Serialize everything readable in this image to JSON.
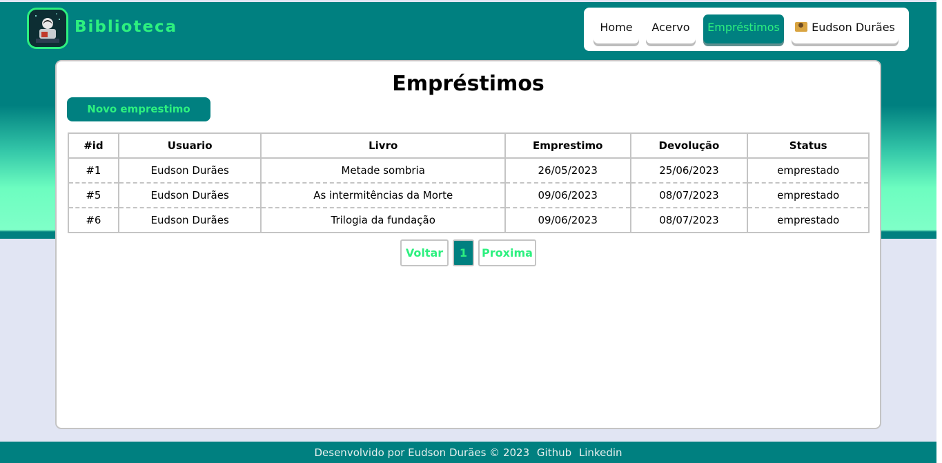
{
  "brand": {
    "name": "Biblioteca"
  },
  "nav": {
    "home": "Home",
    "acervo": "Acervo",
    "emprestimos": "Empréstimos",
    "user": "Eudson Durães"
  },
  "main": {
    "title": "Empréstimos",
    "new_button": "Novo emprestimo",
    "table": {
      "headers": [
        "#id",
        "Usuario",
        "Livro",
        "Emprestimo",
        "Devolução",
        "Status"
      ],
      "rows": [
        [
          "#1",
          "Eudson Durães",
          "Metade sombria",
          "26/05/2023",
          "25/06/2023",
          "emprestado"
        ],
        [
          "#5",
          "Eudson Durães",
          "As intermitências da Morte",
          "09/06/2023",
          "08/07/2023",
          "emprestado"
        ],
        [
          "#6",
          "Eudson Durães",
          "Trilogia da fundação",
          "09/06/2023",
          "08/07/2023",
          "emprestado"
        ]
      ]
    },
    "pager": {
      "prev": "Voltar",
      "page": "1",
      "next": "Proxima"
    }
  },
  "footer": {
    "credit": "Desenvolvido por Eudson Durães © 2023",
    "github": "Github",
    "linkedin": "Linkedin"
  },
  "colors": {
    "primary": "#008080",
    "accent": "#2df07f",
    "background": "#e1e5f3"
  }
}
